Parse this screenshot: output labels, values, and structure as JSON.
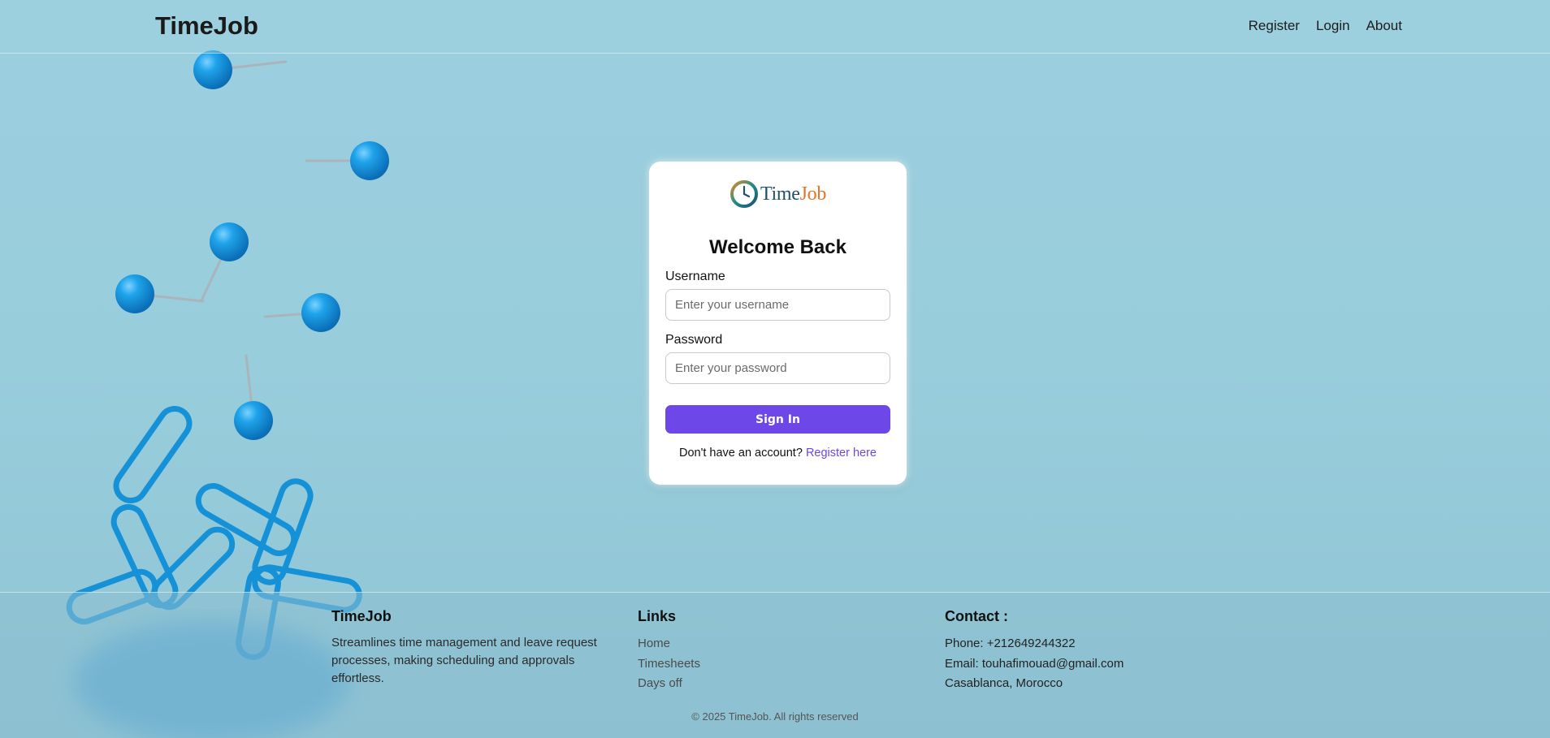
{
  "header": {
    "brand": "TimeJob",
    "nav": [
      "Register",
      "Login",
      "About"
    ]
  },
  "card": {
    "logo": {
      "part1": "Time",
      "part2": "Job"
    },
    "title": "Welcome Back",
    "username_label": "Username",
    "username_placeholder": "Enter your username",
    "password_label": "Password",
    "password_placeholder": "Enter your password",
    "signin_label": "Sign In",
    "register_prompt": "Don't have an account?",
    "register_link": "Register here"
  },
  "footer": {
    "about": {
      "title": "TimeJob",
      "description": "Streamlines time management and leave request processes, making scheduling and approvals effortless."
    },
    "links": {
      "title": "Links",
      "items": [
        "Home",
        "Timesheets",
        "Days off"
      ]
    },
    "contact": {
      "title": "Contact :",
      "phone": "Phone: +212649244322",
      "email": "Email: touhafimouad@gmail.com",
      "address": "Casablanca, Morocco"
    },
    "copyright": "© 2025 TimeJob. All rights reserved"
  },
  "colors": {
    "accent": "#6d47e8",
    "background": "#9fd0de",
    "logo_blue": "#1f4f6b",
    "logo_orange": "#e0762a"
  },
  "icons": [
    "clock-logo-icon"
  ]
}
